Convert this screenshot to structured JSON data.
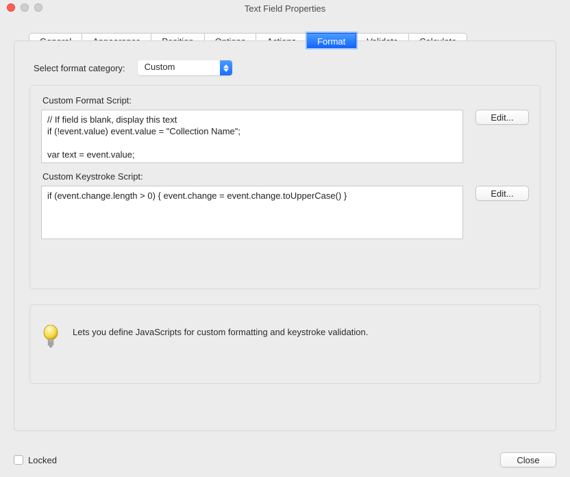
{
  "window": {
    "title": "Text Field Properties"
  },
  "tabs": {
    "general": "General",
    "appearance": "Appearance",
    "position": "Position",
    "options": "Options",
    "actions": "Actions",
    "format": "Format",
    "validate": "Validate",
    "calculate": "Calculate"
  },
  "select": {
    "label": "Select format category:",
    "value": "Custom"
  },
  "scripts": {
    "format_label": "Custom Format Script:",
    "format_code": "// If field is blank, display this text\nif (!event.value) event.value = \"Collection Name\";\n\nvar text = event.value;",
    "keystroke_label": "Custom Keystroke Script:",
    "keystroke_code": "if (event.change.length > 0) { event.change = event.change.toUpperCase() }",
    "edit_label": "Edit..."
  },
  "hint": "Lets you define JavaScripts for custom formatting and keystroke validation.",
  "footer": {
    "locked_label": "Locked",
    "close_label": "Close"
  }
}
